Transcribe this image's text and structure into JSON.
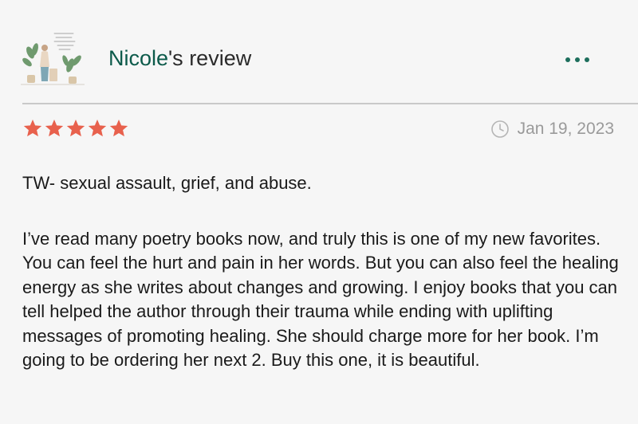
{
  "review": {
    "reviewer_name": "Nicole",
    "title_suffix": "'s review",
    "date": "Jan 19, 2023",
    "rating": 5,
    "rating_max": 5,
    "trigger_warning": "TW- sexual assault, grief, and abuse.",
    "body": "I’ve read many poetry books now, and truly this is one of my new favorites. You can feel the hurt and pain in her words. But you can also feel the healing energy as she writes about changes and growing. I enjoy books that you can tell helped the author through their trauma while ending with uplifting messages of promoting healing. She should charge more for her book. I’m going to be ordering her next 2. Buy this one, it is beautiful."
  },
  "icons": {
    "avatar": "avatar-illustration",
    "more": "more-options-icon",
    "star": "star-icon",
    "clock": "clock-icon"
  },
  "colors": {
    "name": "#0c5a4a",
    "more_dots": "#1d6e5c",
    "star": "#e8614d",
    "date": "#9a9a9a",
    "divider": "#c9c9c9",
    "background": "#f6f6f6"
  }
}
